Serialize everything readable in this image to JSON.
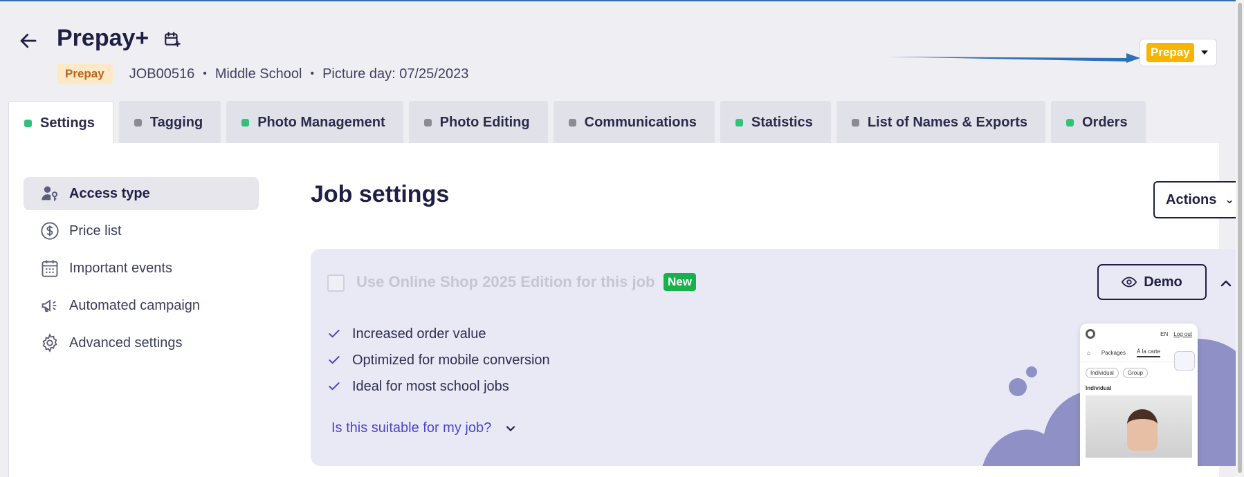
{
  "header": {
    "title": "Prepay+",
    "back_icon": "arrow-left-icon",
    "calendar_icon": "calendar-plus-icon",
    "badge": "Prepay",
    "job_id": "JOB00516",
    "separator": "•",
    "school_type": "Middle School",
    "picture_day": "Picture day: 07/25/2023",
    "mode_selector": {
      "value": "Prepay",
      "color": "#f7b500"
    }
  },
  "tabs": [
    {
      "label": "Settings",
      "status": "green",
      "active": true
    },
    {
      "label": "Tagging",
      "status": "grey",
      "active": false
    },
    {
      "label": "Photo Management",
      "status": "green",
      "active": false
    },
    {
      "label": "Photo Editing",
      "status": "grey",
      "active": false
    },
    {
      "label": "Communications",
      "status": "grey",
      "active": false
    },
    {
      "label": "Statistics",
      "status": "green",
      "active": false
    },
    {
      "label": "List of Names & Exports",
      "status": "grey",
      "active": false
    },
    {
      "label": "Orders",
      "status": "green",
      "active": false
    }
  ],
  "sidebar": {
    "items": [
      {
        "label": "Access type",
        "icon": "user-key-icon",
        "active": true
      },
      {
        "label": "Price list",
        "icon": "dollar-circle-icon",
        "active": false
      },
      {
        "label": "Important events",
        "icon": "calendar-icon",
        "active": false
      },
      {
        "label": "Automated campaign",
        "icon": "megaphone-icon",
        "active": false
      },
      {
        "label": "Advanced settings",
        "icon": "gear-icon",
        "active": false
      }
    ]
  },
  "main": {
    "title": "Job settings",
    "actions_label": "Actions"
  },
  "card": {
    "title": "Use Online Shop 2025 Edition for this job",
    "new_badge": "New",
    "demo_label": "Demo",
    "benefits": [
      "Increased order value",
      "Optimized for mobile conversion",
      "Ideal for most school jobs"
    ],
    "suitable_link": "Is this suitable for my job?",
    "preview": {
      "lang": "EN",
      "logout": "Log out",
      "nav": [
        "Packages",
        "À la carte"
      ],
      "pills": [
        "Individual",
        "Group"
      ],
      "section": "Individual"
    }
  },
  "colors": {
    "accent": "#1e1f44",
    "link": "#4a47c7",
    "status_green": "#33c07a",
    "status_grey": "#8b8b96",
    "new_badge": "#16b24a",
    "prepay_badge_bg": "#fde9c8",
    "prepay_badge_text": "#b8651a"
  }
}
